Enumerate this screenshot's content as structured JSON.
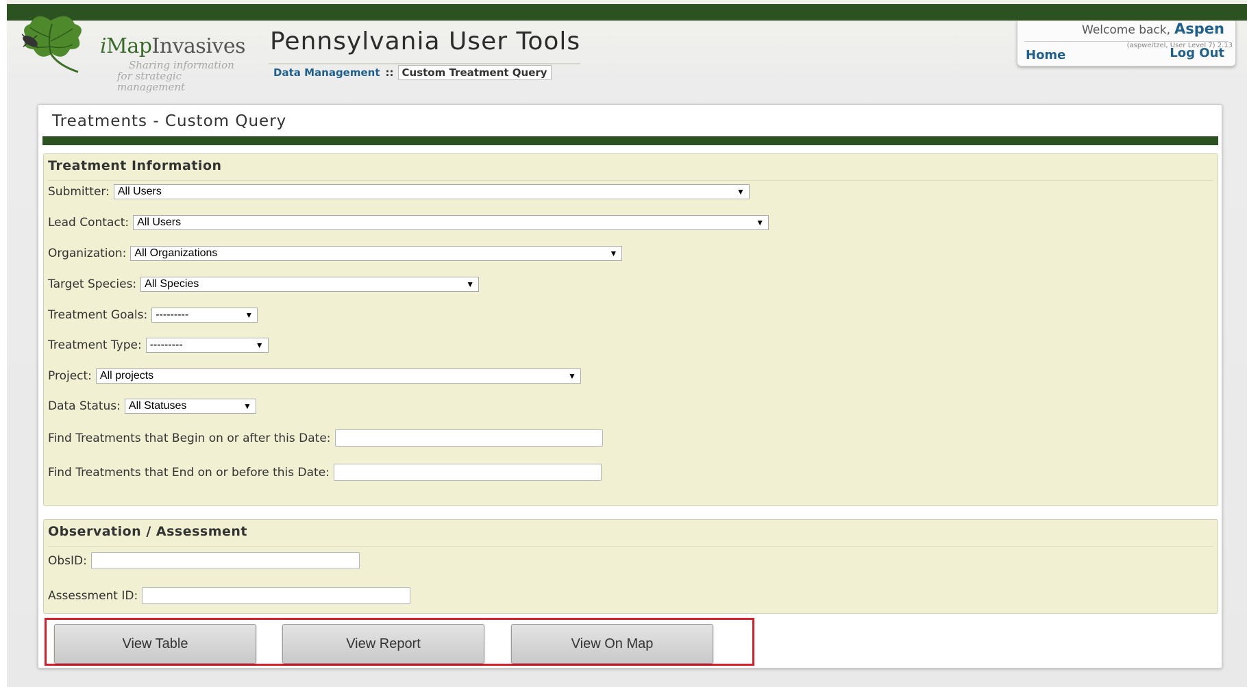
{
  "header": {
    "logo": {
      "prefix": "i",
      "map": "Map",
      "invasives": "Invasives",
      "tagline_1": "Sharing information",
      "tagline_2": "for strategic management"
    },
    "title": "Pennsylvania User Tools",
    "breadcrumb": {
      "parent": "Data Management",
      "separator": "::",
      "current": "Custom Treatment Query"
    }
  },
  "user_box": {
    "welcome": "Welcome back,",
    "username": "Aspen",
    "sub": "(aspweitzel, User Level 7) 2.13",
    "home": "Home",
    "logout": "Log Out"
  },
  "panel": {
    "title": "Treatments - Custom Query",
    "treatment_section": {
      "title": "Treatment Information",
      "submitter": {
        "label": "Submitter:",
        "value": "All Users"
      },
      "lead_contact": {
        "label": "Lead Contact:",
        "value": "All Users"
      },
      "organization": {
        "label": "Organization:",
        "value": "All Organizations"
      },
      "target_species": {
        "label": "Target Species:",
        "value": "All Species"
      },
      "treatment_goals": {
        "label": "Treatment Goals:",
        "value": "---------"
      },
      "treatment_type": {
        "label": "Treatment Type:",
        "value": "---------"
      },
      "project": {
        "label": "Project:",
        "value": "All projects"
      },
      "data_status": {
        "label": "Data Status:",
        "value": "All Statuses"
      },
      "begin_date": {
        "label": "Find Treatments that Begin on or after this Date:",
        "value": ""
      },
      "end_date": {
        "label": "Find Treatments that End on or before this Date:",
        "value": ""
      }
    },
    "observation_section": {
      "title": "Observation / Assessment",
      "obs_id": {
        "label": "ObsID:",
        "value": ""
      },
      "assessment_id": {
        "label": "Assessment ID:",
        "value": ""
      }
    },
    "buttons": {
      "view_table": "View Table",
      "view_report": "View Report",
      "view_map": "View On Map"
    }
  },
  "colors": {
    "dark_green": "#2b5220",
    "section_bg": "#f1f0d2",
    "link_blue": "#1f5f8b",
    "highlight_red": "#d5202b"
  },
  "icons": {
    "dropdown": "▼"
  }
}
